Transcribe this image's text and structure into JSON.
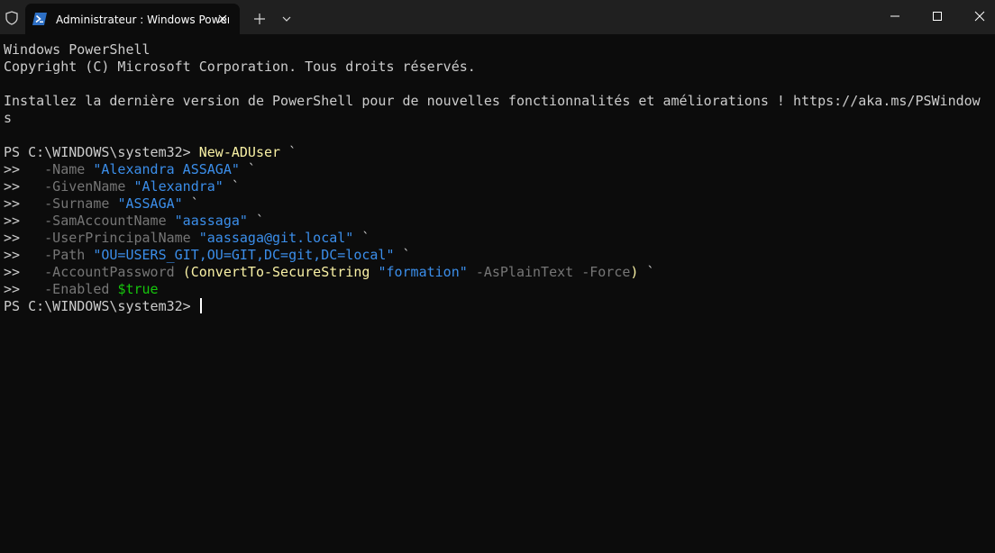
{
  "window": {
    "tab_title": "Administrateur : Windows PowerShell",
    "new_tab_symbol": "+",
    "icons": [
      "shield-icon",
      "powershell-icon",
      "close-icon",
      "plus-icon",
      "chevron-down-icon",
      "minimize-icon",
      "maximize-icon",
      "close-window-icon"
    ]
  },
  "terminal": {
    "header_line1": "Windows PowerShell",
    "header_line2": "Copyright (C) Microsoft Corporation. Tous droits réservés.",
    "upgrade_line1": "Installez la dernière version de PowerShell pour de nouvelles fonctionnalités et améliorations ! https://aka.ms/PSWindow",
    "upgrade_line2": "s",
    "prompt": "PS C:\\WINDOWS\\system32> ",
    "command": "New-ADUser",
    "continuation": " `",
    "cont_prompt": ">>   ",
    "params": [
      {
        "name": "-Name",
        "value": "\"Alexandra ASSAGA\""
      },
      {
        "name": "-GivenName",
        "value": "\"Alexandra\""
      },
      {
        "name": "-Surname",
        "value": "\"ASSAGA\""
      },
      {
        "name": "-SamAccountName",
        "value": "\"aassaga\""
      },
      {
        "name": "-UserPrincipalName",
        "value": "\"aassaga@git.local\""
      },
      {
        "name": "-Path",
        "value": "\"OU=USERS_GIT,OU=GIT,DC=git,DC=local\""
      }
    ],
    "password_param": "-AccountPassword",
    "paren_open": "(",
    "convert_cmd": "ConvertTo-SecureString",
    "password_value": "\"formation\"",
    "plaintext_switch": "-AsPlainText",
    "force_switch": "-Force",
    "paren_close": ")",
    "enabled_param": "-Enabled",
    "enabled_value": "$true",
    "final_prompt": "PS C:\\WINDOWS\\system32> "
  },
  "colors": {
    "background": "#0c0c0c",
    "titlebar": "#202020",
    "command": "#f9f1a5",
    "parameter": "#767676",
    "string": "#3b8eea",
    "variable": "#16c60c",
    "text": "#cccccc"
  }
}
